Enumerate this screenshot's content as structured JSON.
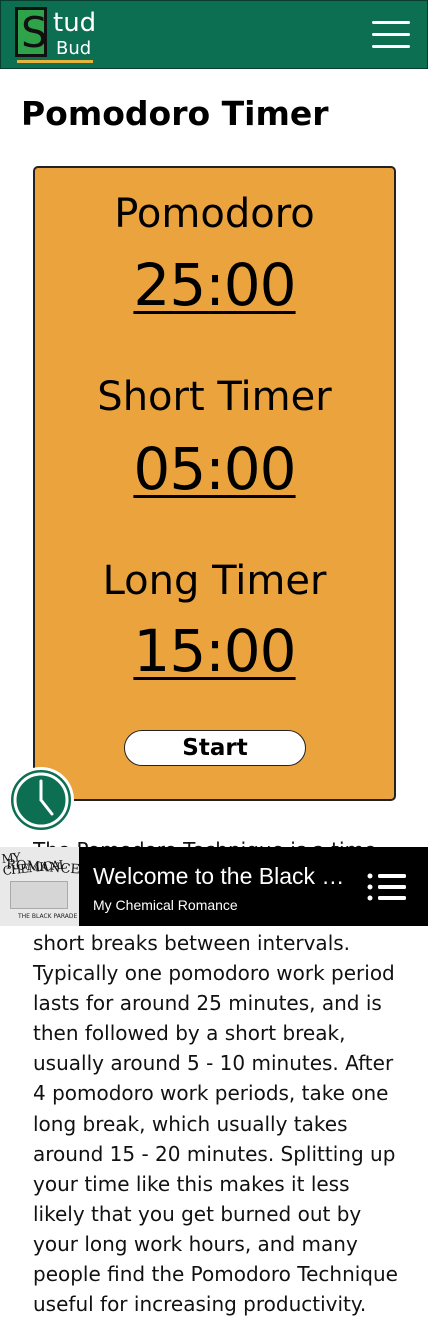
{
  "app": {
    "logo_s": "S",
    "logo_tud": "tud",
    "logo_bud": "Bud"
  },
  "page": {
    "title": "Pomodoro Timer"
  },
  "timers": [
    {
      "label": "Pomodoro",
      "value": "25:00"
    },
    {
      "label": "Short Timer",
      "value": "05:00"
    },
    {
      "label": "Long Timer",
      "value": "15:00"
    }
  ],
  "start_label": "Start",
  "description": {
    "partial_line": "The Pomodoro Technique is a time",
    "text": "short breaks between intervals. Typically one pomodoro work period lasts for around 25 minutes, and is then followed by a short break, usually around 5 - 10 minutes. After 4 pomodoro work periods, take one long break, which usually takes around 15 - 20 minutes. Splitting up your time like this makes it less likely that you get burned out by your long work hours, and many people find the Pomodoro Technique useful for increasing productivity."
  },
  "player": {
    "title": "Welcome to the Black Parade",
    "artist": "My Chemical Romance",
    "album_art_text_1": "MY CHEMICAL",
    "album_art_text_2": "ROMANCE",
    "album_art_text_3": "THE BLACK PARADE"
  },
  "icons": {
    "menu": "hamburger-icon",
    "clock": "clock-icon",
    "queue": "queue-icon"
  },
  "colors": {
    "navbar": "#0d6f52",
    "timer_panel": "#eaa33d",
    "logo_green": "#2fa349",
    "accent_gold": "#e6b43c",
    "player_bg": "#000000"
  }
}
